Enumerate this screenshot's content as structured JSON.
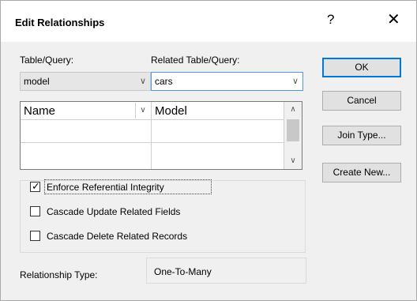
{
  "dialog": {
    "title": "Edit Relationships",
    "help_glyph": "?",
    "close_glyph": "✕"
  },
  "table_query": {
    "label": "Table/Query:",
    "value": "model"
  },
  "related_table_query": {
    "label": "Related Table/Query:",
    "value": "cars"
  },
  "fields_grid": {
    "rows": [
      {
        "left": "Name",
        "right": "Model"
      },
      {
        "left": "",
        "right": ""
      },
      {
        "left": "",
        "right": ""
      }
    ]
  },
  "options": {
    "enforce_integrity": {
      "label": "Enforce Referential Integrity",
      "checked": true
    },
    "cascade_update": {
      "label": "Cascade Update Related Fields",
      "checked": false
    },
    "cascade_delete": {
      "label": "Cascade Delete Related Records",
      "checked": false
    }
  },
  "relationship_type": {
    "label": "Relationship Type:",
    "value": "One-To-Many"
  },
  "buttons": {
    "ok": "OK",
    "cancel": "Cancel",
    "join_type": "Join Type...",
    "create_new": "Create New..."
  },
  "icons": {
    "chevron_down": "chevron-down-icon",
    "chevron_up": "chevron-up-icon",
    "check": "check-icon"
  },
  "colors": {
    "accent": "#0078d7",
    "combo_focus": "#4f97e8"
  }
}
